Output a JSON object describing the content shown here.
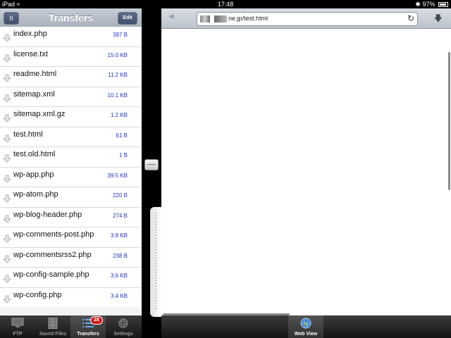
{
  "status_bar": {
    "device": "iPad",
    "time": "17:48",
    "battery": "97%"
  },
  "transfers_panel": {
    "title": "Transfers",
    "pause_label": "II",
    "edit_label": "Edit",
    "files": [
      {
        "name": "index.php",
        "size": "397 B"
      },
      {
        "name": "license.txt",
        "size": "15.0 KB"
      },
      {
        "name": "readme.html",
        "size": "11.2 KB"
      },
      {
        "name": "sitemap.xml",
        "size": "10.1 KB"
      },
      {
        "name": "sitemap.xml.gz",
        "size": "1.2 KB"
      },
      {
        "name": "test.html",
        "size": "61 B"
      },
      {
        "name": "test.old.html",
        "size": "1 B"
      },
      {
        "name": "wp-app.php",
        "size": "39.5 KB"
      },
      {
        "name": "wp-atom.php",
        "size": "220 B"
      },
      {
        "name": "wp-blog-header.php",
        "size": "274 B"
      },
      {
        "name": "wp-comments-post.php",
        "size": "3.8 KB"
      },
      {
        "name": "wp-commentsrss2.php",
        "size": "238 B"
      },
      {
        "name": "wp-config-sample.php",
        "size": "3.6 KB"
      },
      {
        "name": "wp-config.php",
        "size": "3.4 KB"
      }
    ]
  },
  "tab_bar": {
    "tabs": [
      {
        "label": "FTP",
        "icon": "monitor-icon"
      },
      {
        "label": "Saved Files",
        "icon": "cabinet-icon"
      },
      {
        "label": "Transfers",
        "icon": "list-icon",
        "badge": "28"
      },
      {
        "label": "Settings",
        "icon": "gear-icon"
      }
    ],
    "active": "Transfers"
  },
  "browser": {
    "url": "ne.jp/test.html",
    "tab_label": "Web View"
  },
  "colors": {
    "size_text": "#2331c7",
    "badge": "#d01a1a",
    "toolbar_bg": "#bcc3cc"
  }
}
